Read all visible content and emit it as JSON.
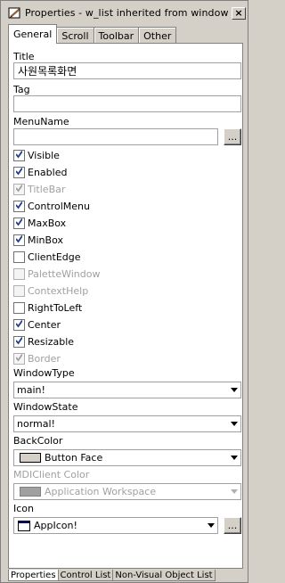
{
  "window": {
    "title": "Properties - w_list  inherited  from  window",
    "close_glyph": "×"
  },
  "tabs": [
    {
      "label": "General",
      "active": true
    },
    {
      "label": "Scroll",
      "active": false
    },
    {
      "label": "Toolbar",
      "active": false
    },
    {
      "label": "Other",
      "active": false
    }
  ],
  "fields": {
    "title_label": "Title",
    "title_value": "사원목록화면",
    "tag_label": "Tag",
    "tag_value": "",
    "menuname_label": "MenuName",
    "menuname_value": "",
    "dots": "..."
  },
  "checkboxes": [
    {
      "label": "Visible",
      "checked": true,
      "enabled": true
    },
    {
      "label": "Enabled",
      "checked": true,
      "enabled": true
    },
    {
      "label": "TitleBar",
      "checked": true,
      "enabled": false
    },
    {
      "label": "ControlMenu",
      "checked": true,
      "enabled": true
    },
    {
      "label": "MaxBox",
      "checked": true,
      "enabled": true
    },
    {
      "label": "MinBox",
      "checked": true,
      "enabled": true
    },
    {
      "label": "ClientEdge",
      "checked": false,
      "enabled": true
    },
    {
      "label": "PaletteWindow",
      "checked": false,
      "enabled": false
    },
    {
      "label": "ContextHelp",
      "checked": false,
      "enabled": false
    },
    {
      "label": "RightToLeft",
      "checked": false,
      "enabled": true
    },
    {
      "label": "Center",
      "checked": true,
      "enabled": true
    },
    {
      "label": "Resizable",
      "checked": true,
      "enabled": true
    },
    {
      "label": "Border",
      "checked": true,
      "enabled": false
    }
  ],
  "dropdowns": {
    "windowtype_label": "WindowType",
    "windowtype_value": "main!",
    "windowstate_label": "WindowState",
    "windowstate_value": "normal!",
    "backcolor_label": "BackColor",
    "backcolor_value": "Button Face",
    "mdiclient_label": "MDIClient Color",
    "mdiclient_value": "Application Workspace",
    "icon_label": "Icon",
    "icon_value": "AppIcon!"
  },
  "bottom_tabs": [
    {
      "label": "Properties",
      "active": true
    },
    {
      "label": "Control List",
      "active": false
    },
    {
      "label": "Non-Visual Object List",
      "active": false
    }
  ],
  "colors": {
    "face": "#d4d0c8",
    "button_face_swatch": "#d4d0c8",
    "app_workspace_swatch": "#a0a0a0",
    "check_color": "#1f3f8f"
  }
}
